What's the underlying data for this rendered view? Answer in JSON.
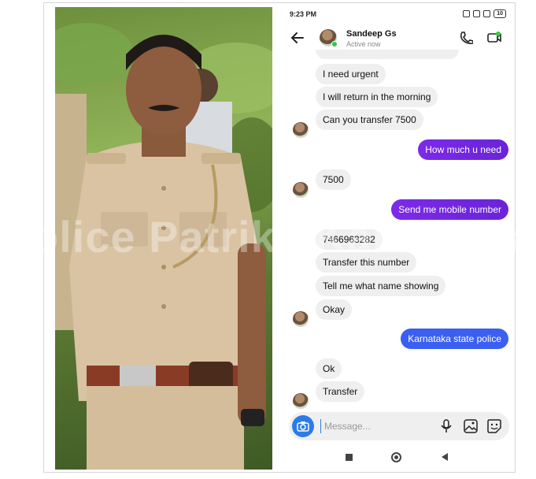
{
  "status_bar": {
    "time": "9:23 PM",
    "battery": "10"
  },
  "header": {
    "contact_name": "Sandeep Gs",
    "contact_status": "Active now"
  },
  "messages": [
    {
      "direction": "in",
      "text": "I need urgent"
    },
    {
      "direction": "in",
      "text": "I will return in the morning"
    },
    {
      "direction": "in",
      "text": "Can you transfer 7500"
    },
    {
      "direction": "out",
      "text": "How much u need"
    },
    {
      "direction": "in",
      "text": "7500"
    },
    {
      "direction": "out",
      "text": "Send me mobile number"
    },
    {
      "direction": "in",
      "text": "7466963282"
    },
    {
      "direction": "in",
      "text": "Transfer this number"
    },
    {
      "direction": "in",
      "text": "Tell me what name showing"
    },
    {
      "direction": "in",
      "text": "Okay"
    },
    {
      "direction": "out",
      "text": "Karnataka state police"
    },
    {
      "direction": "in",
      "text": "Ok"
    },
    {
      "direction": "in",
      "text": "Transfer"
    }
  ],
  "composer": {
    "placeholder": "Message..."
  },
  "watermark": "Police Patrike Karnataka",
  "colors": {
    "outgoing_purple": "#7c2ae8",
    "outgoing_blue": "#3b5ff0",
    "incoming_gray": "#efefef",
    "camera_blue": "#2b7be8",
    "online_green": "#2ecc40"
  },
  "icons": [
    "back-arrow-icon",
    "phone-icon",
    "video-call-icon",
    "camera-icon",
    "microphone-icon",
    "gallery-icon",
    "sticker-icon"
  ]
}
